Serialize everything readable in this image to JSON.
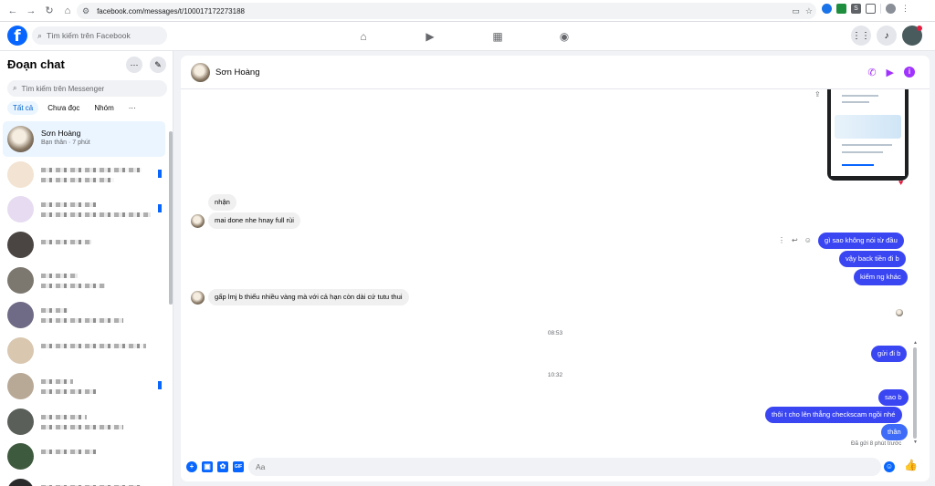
{
  "browser": {
    "url": "facebook.com/messages/t/100017172273188",
    "nav_icons": [
      "back-icon",
      "forward-icon",
      "reload-icon",
      "home-icon"
    ]
  },
  "facebook": {
    "logo": "f",
    "search_placeholder": "Tìm kiếm trên Facebook"
  },
  "sidebar": {
    "title": "Đoạn chat",
    "search_placeholder": "Tìm kiếm trên Messenger",
    "tabs": [
      {
        "label": "Tất cả",
        "active": true
      },
      {
        "label": "Chưa đọc",
        "active": false
      },
      {
        "label": "Nhóm",
        "active": false
      },
      {
        "label": "···",
        "active": false
      }
    ],
    "active_chat": {
      "name": "Sơn Hoàng",
      "subtitle": "Bạn thân · 7 phút"
    }
  },
  "chat": {
    "contact_name": "Sơn Hoàng",
    "messages_in": [
      {
        "text": "nhận"
      },
      {
        "text": "mai done nhe hnay full rùi"
      },
      {
        "text": "gấp lmj b thiếu nhiều vàng mà với cả hạn còn dài cứ tutu thui"
      }
    ],
    "messages_out": [
      {
        "text": "gì sao không nói từ đầu"
      },
      {
        "text": "vậy back tiền đi b"
      },
      {
        "text": "kiếm ng khác"
      },
      {
        "text": "gửi đi b"
      },
      {
        "text": "sao b"
      },
      {
        "text": "thôi t cho lên thẳng checkscam ngồi nhé"
      },
      {
        "text": "thân"
      }
    ],
    "timestamps": [
      "08:53",
      "10:32"
    ],
    "sent_status": "Đã gửi 8 phút trước",
    "composer_placeholder": "Aa",
    "composer_icons": [
      "plus-icon",
      "image-icon",
      "sticker-icon",
      "gif-icon"
    ]
  },
  "colors": {
    "facebook_blue": "#0866ff",
    "messenger_purple": "#a033ff",
    "outgoing_bubble": "#3b46f3"
  }
}
